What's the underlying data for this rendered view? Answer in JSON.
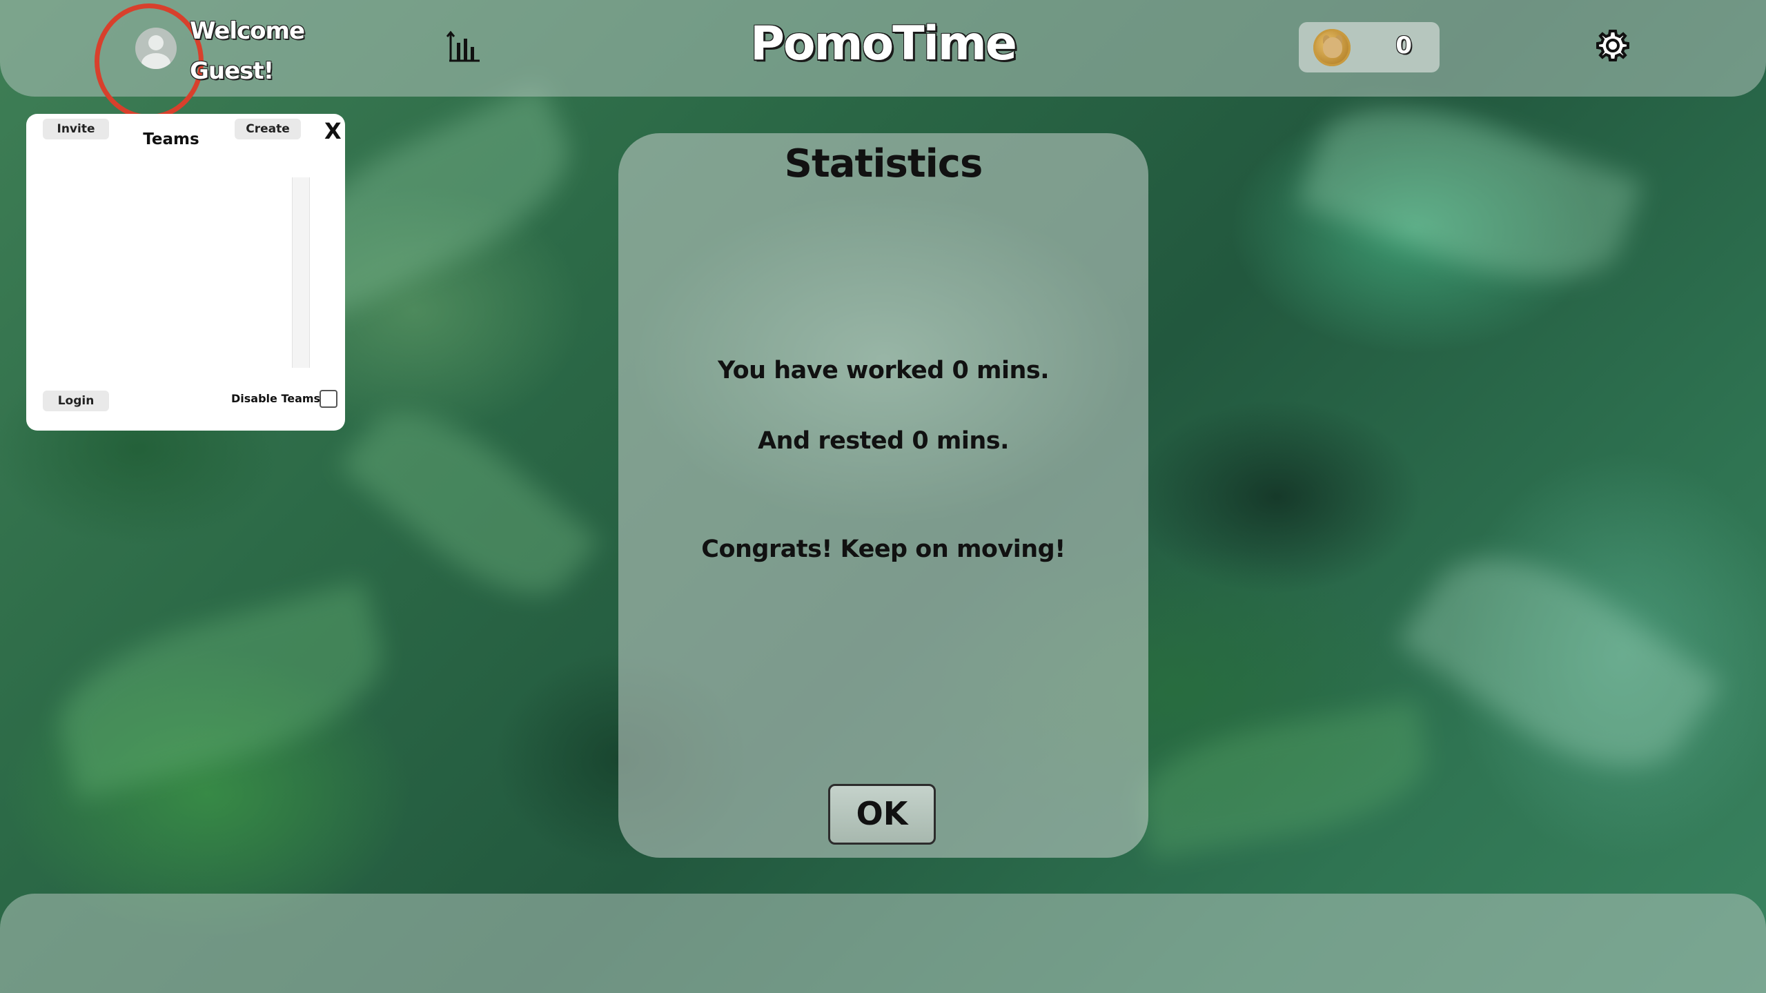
{
  "header": {
    "welcome_line1": "Welcome",
    "welcome_line2": "Guest!",
    "app_title": "PomoTime",
    "coin_count": "0",
    "avatar_icon": "user-avatar-icon",
    "stats_icon": "bar-chart-icon",
    "settings_icon": "gear-icon",
    "coin_icon": "doge-coin-icon"
  },
  "teams_panel": {
    "invite_label": "Invite",
    "create_label": "Create",
    "title": "Teams",
    "close_label": "X",
    "login_label": "Login",
    "disable_label": "Disable Teams",
    "disable_checked": false
  },
  "statistics": {
    "title": "Statistics",
    "worked_text": "You have worked 0 mins.",
    "rested_text": "And rested 0 mins.",
    "congrats_text": "Congrats! Keep on moving!",
    "ok_label": "OK"
  },
  "colors": {
    "highlight_ring": "#d8402c",
    "panel_bg": "#ffffff",
    "text_dark": "#111111"
  }
}
